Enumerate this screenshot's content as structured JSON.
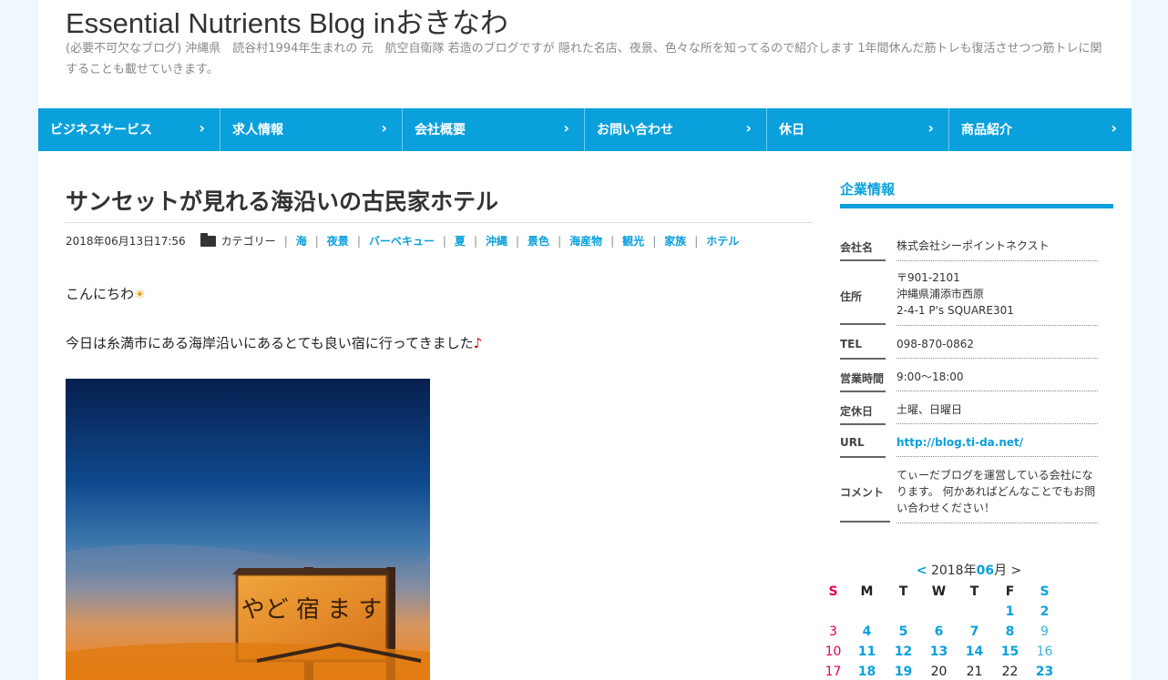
{
  "header": {
    "title": "Essential Nutrients Blog inおきなわ",
    "description": "(必要不可欠なブログ) 沖縄県　読谷村1994年生まれの 元　航空自衛隊 若造のブログですが 隠れた名店、夜景、色々な所を知ってるので紹介します 1年間休んだ筋トレも復活させつつ筋トレに関することも載せていきます。"
  },
  "nav": {
    "items": [
      {
        "label": "ビジネスサービス"
      },
      {
        "label": "求人情報"
      },
      {
        "label": "会社概要"
      },
      {
        "label": "お問い合わせ"
      },
      {
        "label": "休日"
      },
      {
        "label": "商品紹介"
      }
    ],
    "arrow": "›"
  },
  "post": {
    "title": "サンセットが見れる海沿いの古民家ホテル",
    "date": "2018年06月13日17:56",
    "category_label": "カテゴリー",
    "categories": [
      "海",
      "夜景",
      "バーベキュー",
      "夏",
      "沖縄",
      "景色",
      "海産物",
      "観光",
      "家族",
      "ホテル"
    ],
    "line1": "こんにちわ",
    "line2": "今日は糸満市にある海岸沿いにあるとても良い宿に行ってきました",
    "sun_icon": "☀",
    "note_icon": "♪",
    "photo_sign_text": "やど 宿 ま す"
  },
  "sidebar": {
    "title": "企業情報",
    "rows": [
      {
        "label": "会社名",
        "value": "株式会社シーポイントネクスト"
      },
      {
        "label": "住所",
        "value": "〒901-2101\n沖縄県浦添市西原\n2-4-1 P's SQUARE301"
      },
      {
        "label": "TEL",
        "value": "098-870-0862"
      },
      {
        "label": "営業時間",
        "value": "9:00〜18:00"
      },
      {
        "label": "定休日",
        "value": "土曜、日曜日"
      },
      {
        "label": "URL",
        "value": "http://blog.ti-da.net/"
      },
      {
        "label": "コメント",
        "value": "てぃーだブログを運営している会社になります。 何かあればどんなことでもお問い合わせください！"
      }
    ]
  },
  "calendar": {
    "prev": "<",
    "next": ">",
    "year_text": "2018年",
    "month": "06",
    "month_suffix": "月",
    "weekdays": [
      "S",
      "M",
      "T",
      "W",
      "T",
      "F",
      "S"
    ],
    "weeks": [
      [
        "",
        "",
        "",
        "",
        "",
        "1",
        "2"
      ],
      [
        "3",
        "4",
        "5",
        "6",
        "7",
        "8",
        "9"
      ],
      [
        "10",
        "11",
        "12",
        "13",
        "14",
        "15",
        "16"
      ],
      [
        "17",
        "18",
        "19",
        "20",
        "21",
        "22",
        "23"
      ]
    ],
    "colors": {
      "sunday": "#e5005a",
      "link": "#0aa0dc",
      "plain": "#222222",
      "saturday_plain": "#3bb0d8"
    }
  }
}
